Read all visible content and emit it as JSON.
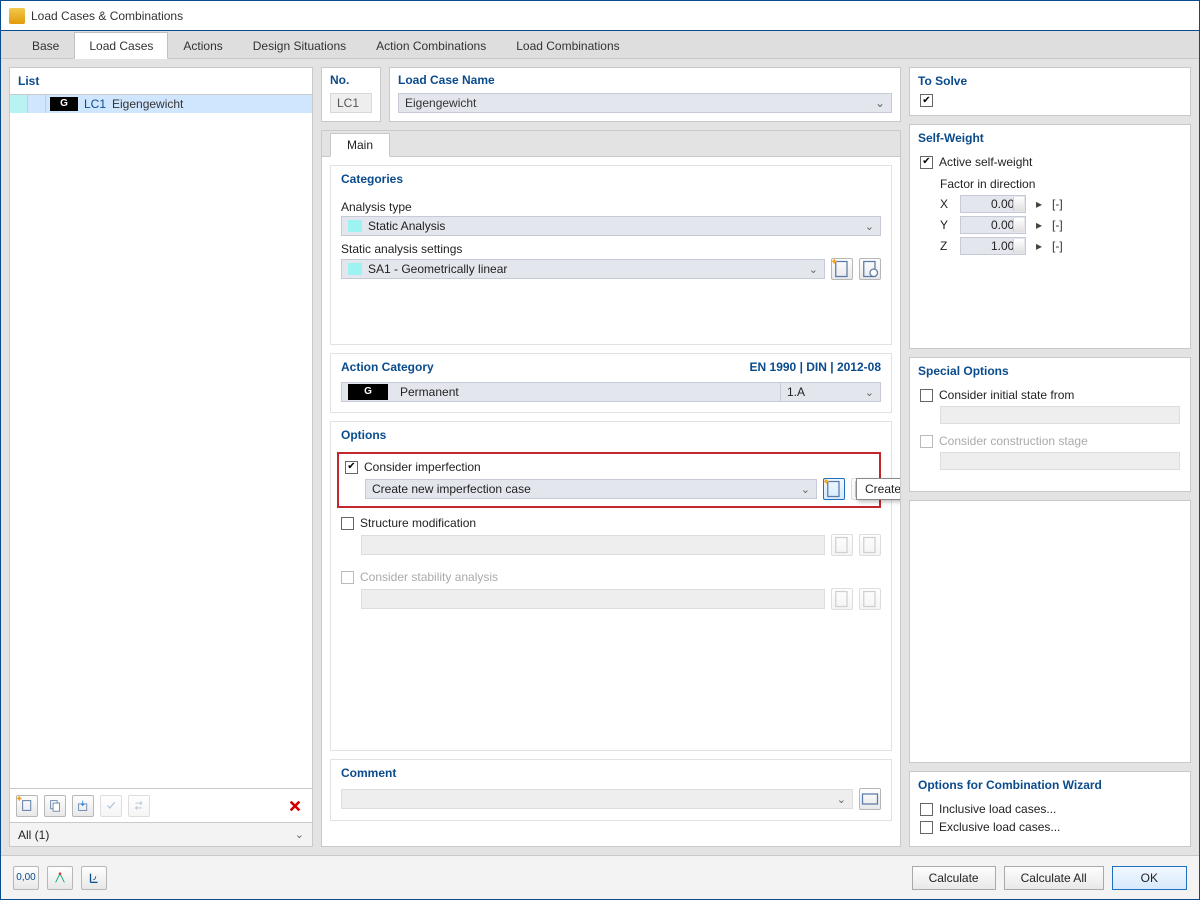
{
  "window": {
    "title": "Load Cases & Combinations"
  },
  "tabs": [
    "Base",
    "Load Cases",
    "Actions",
    "Design Situations",
    "Action Combinations",
    "Load Combinations"
  ],
  "active_tab": 1,
  "list": {
    "header": "List",
    "items": [
      {
        "badge": "G",
        "code": "LC1",
        "name": "Eigengewicht"
      }
    ],
    "filter": "All (1)"
  },
  "top": {
    "no_label": "No.",
    "no_value": "LC1",
    "name_label": "Load Case Name",
    "name_value": "Eigengewicht"
  },
  "inner_tab": "Main",
  "categories": {
    "title": "Categories",
    "analysis_type_label": "Analysis type",
    "analysis_type_value": "Static Analysis",
    "sas_label": "Static analysis settings",
    "sas_value": "SA1 - Geometrically linear"
  },
  "action_category": {
    "title": "Action Category",
    "standard": "EN 1990 | DIN | 2012-08",
    "badge": "G",
    "value": "Permanent",
    "code": "1.A"
  },
  "options": {
    "title": "Options",
    "consider_imperfection": "Consider imperfection",
    "imperf_combo": "Create new imperfection case",
    "tooltip": "Create New Imperfection Case...",
    "structure_mod": "Structure modification",
    "stability": "Consider stability analysis"
  },
  "comment": {
    "title": "Comment"
  },
  "tosolve": {
    "title": "To Solve"
  },
  "selfweight": {
    "title": "Self-Weight",
    "active": "Active self-weight",
    "factor_label": "Factor in direction",
    "rows": [
      {
        "axis": "X",
        "val": "0.000",
        "unit": "[-]"
      },
      {
        "axis": "Y",
        "val": "0.000",
        "unit": "[-]"
      },
      {
        "axis": "Z",
        "val": "1.000",
        "unit": "[-]"
      }
    ]
  },
  "special": {
    "title": "Special Options",
    "initial": "Consider initial state from",
    "stage": "Consider construction stage"
  },
  "combo_wizard": {
    "title": "Options for Combination Wizard",
    "inclusive": "Inclusive load cases...",
    "exclusive": "Exclusive load cases..."
  },
  "footer": {
    "calculate": "Calculate",
    "calculate_all": "Calculate All",
    "ok": "OK",
    "units_btn": "0,00"
  }
}
